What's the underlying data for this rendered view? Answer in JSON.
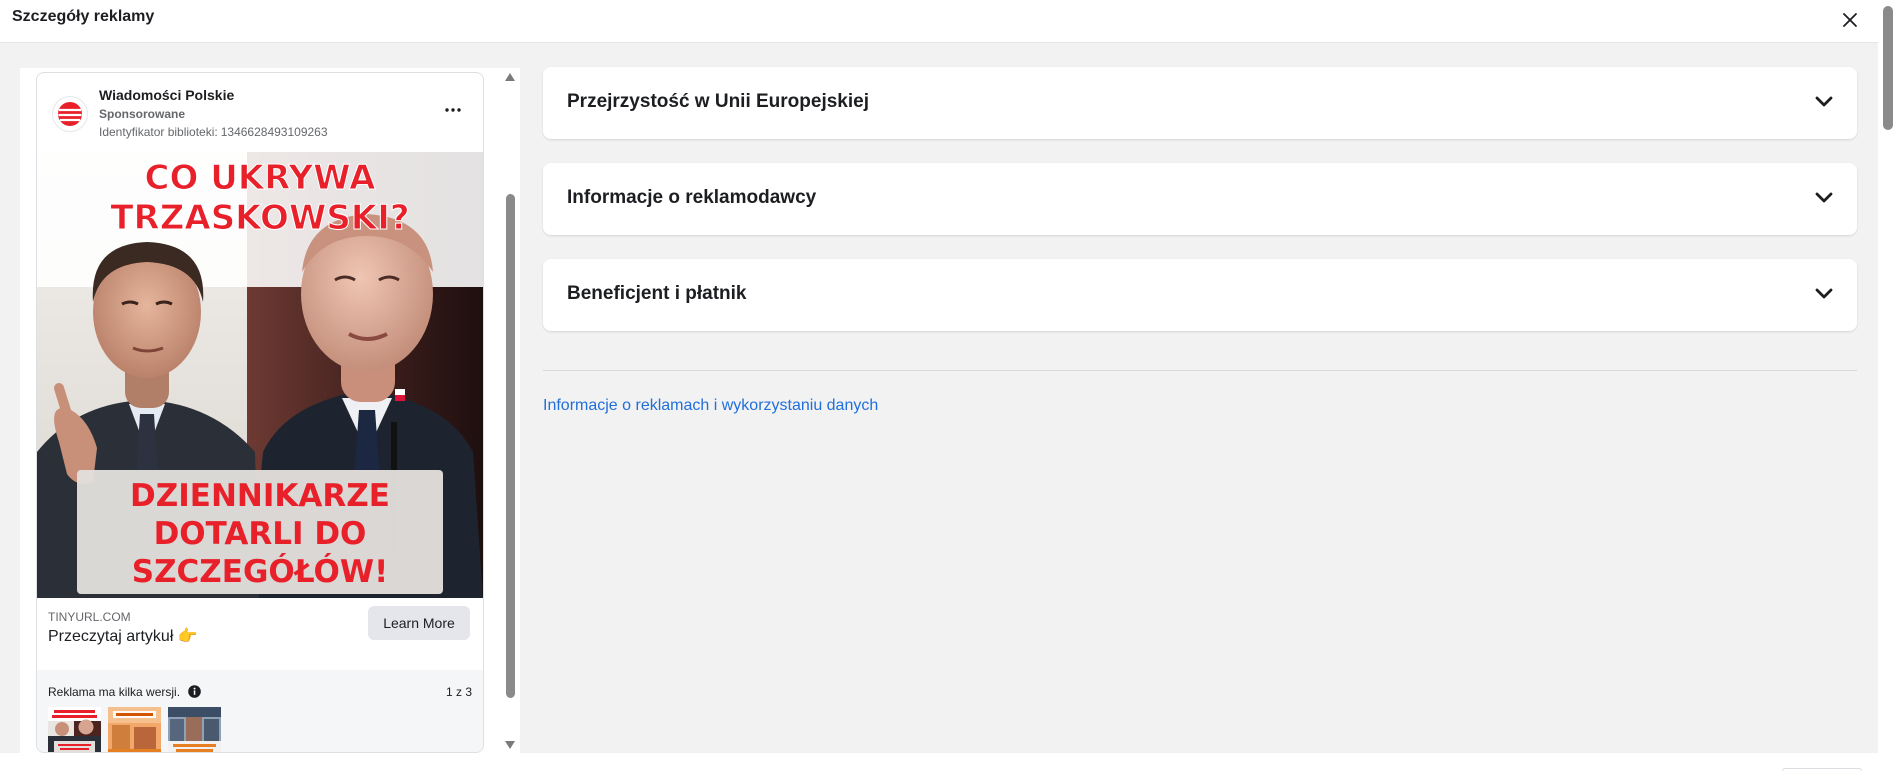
{
  "header": {
    "title": "Szczegóły reklamy"
  },
  "ad": {
    "page_name": "Wiadomości Polskie",
    "sponsored": "Sponsorowane",
    "library_id_label": "Identyfikator biblioteki:",
    "library_id": "1346628493109263",
    "image": {
      "headline_line1": "CO UKRYWA",
      "headline_line2": "TRZASKOWSKI?",
      "caption_line1": "DZIENNIKARZE",
      "caption_line2": "DOTARLI DO",
      "caption_line3": "SZCZEGÓŁÓW!"
    },
    "domain": "TINYURL.COM",
    "link_title": "Przeczytaj artykuł 👉",
    "cta_label": "Learn More",
    "versions_label": "Reklama ma kilka wersji.",
    "versions_count": "1 z 3",
    "thumbnails": [
      {
        "name": "version-1-thumbnail",
        "text": "CO UKRYWA TRZASKOWSKI?"
      },
      {
        "name": "version-2-thumbnail",
        "text": "NOWA OKAZJA"
      },
      {
        "name": "version-3-thumbnail",
        "text": "NOWA OKAZJA"
      }
    ]
  },
  "sections": [
    {
      "label": "Przejrzystość w Unii Europejskiej"
    },
    {
      "label": "Informacje o reklamodawcy"
    },
    {
      "label": "Beneficjent i płatnik"
    }
  ],
  "data_link": "Informacje o reklamach i wykorzystaniu danych",
  "icons": {
    "close": "close-icon",
    "more": "more-options-icon",
    "chevron": "chevron-down-icon",
    "info": "info-icon",
    "scroll_up": "scroll-up-arrow-icon",
    "scroll_down": "scroll-down-arrow-icon"
  },
  "colors": {
    "brand_red": "#e8202a",
    "link_blue": "#216fdb",
    "panel_bg": "#f2f2f2"
  }
}
